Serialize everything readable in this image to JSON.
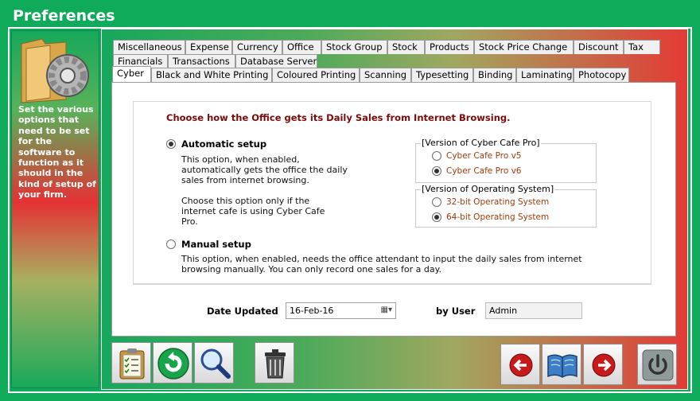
{
  "window": {
    "title": "Preferences"
  },
  "sidebar": {
    "description": "Set the various options that need to be set for the software to function as it should in the kind of setup of your firm.",
    "icon": "folder-gear-icon"
  },
  "tabs": {
    "row1": [
      "Miscellaneous",
      "Expense",
      "Currency",
      "Office",
      "Stock Group",
      "Stock",
      "Products",
      "Stock Price Change",
      "Discount",
      "Tax"
    ],
    "row2": [
      "Financials",
      "Transactions",
      "Database Server"
    ],
    "row3": [
      "Cyber",
      "Black and White Printing",
      "Coloured Printing",
      "Scanning",
      "Typesetting",
      "Binding",
      "Laminating",
      "Photocopy"
    ],
    "active": "Cyber"
  },
  "cyber": {
    "heading": "Choose how the Office gets its Daily Sales from Internet Browsing.",
    "automatic": {
      "label": "Automatic setup",
      "selected": true,
      "desc1": "This option, when enabled, automatically gets the office the daily sales from internet browsing.",
      "desc2": "Choose this option only if the internet cafe is using Cyber Cafe Pro."
    },
    "manual": {
      "label": "Manual setup",
      "selected": false,
      "desc": "This option, when enabled, needs the office attendant to input the daily sales from internet browsing manually. You can only record one sales for a day."
    },
    "version_group": {
      "title": "[Version of Cyber Cafe Pro]",
      "options": [
        {
          "label": "Cyber Cafe Pro v5",
          "selected": false
        },
        {
          "label": "Cyber Cafe Pro v6",
          "selected": true
        }
      ]
    },
    "os_group": {
      "title": "[Version of Operating System]",
      "options": [
        {
          "label": "32-bit Operating System",
          "selected": false
        },
        {
          "label": "64-bit Operating System",
          "selected": true
        }
      ]
    }
  },
  "footer": {
    "date_label": "Date Updated",
    "date_value": "16-Feb-16",
    "user_label": "by User",
    "user_value": "Admin"
  },
  "toolbar": {
    "left": [
      "clipboard-checklist-icon",
      "undo-icon",
      "search-icon",
      "trash-icon"
    ],
    "right": [
      "back-arrow-icon",
      "open-book-icon",
      "forward-arrow-icon",
      "power-icon"
    ]
  },
  "colors": {
    "green": "#0faa5a",
    "red": "#e33a36",
    "heading": "#7b0a0a",
    "option": "#a23a0a"
  }
}
